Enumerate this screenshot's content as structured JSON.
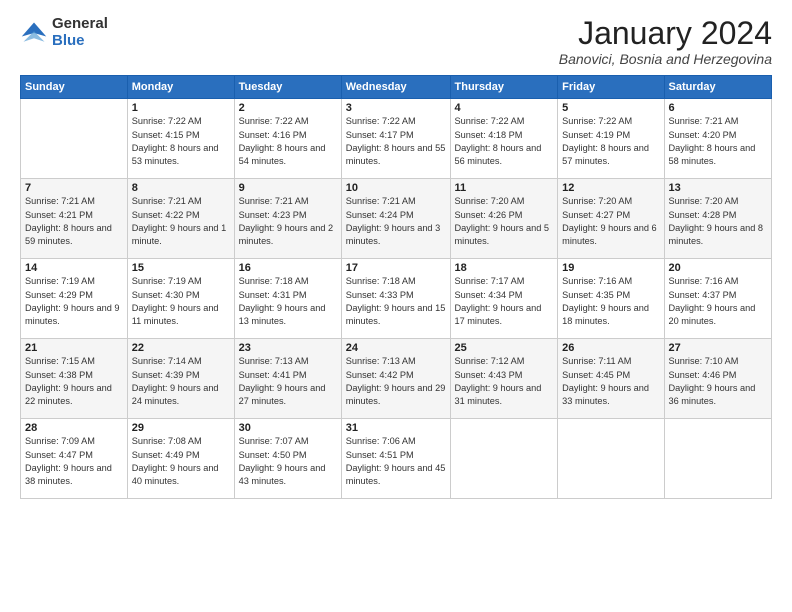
{
  "logo": {
    "general": "General",
    "blue": "Blue"
  },
  "header": {
    "title": "January 2024",
    "location": "Banovici, Bosnia and Herzegovina"
  },
  "weekdays": [
    "Sunday",
    "Monday",
    "Tuesday",
    "Wednesday",
    "Thursday",
    "Friday",
    "Saturday"
  ],
  "weeks": [
    [
      null,
      {
        "day": "1",
        "sunrise": "7:22 AM",
        "sunset": "4:15 PM",
        "daylight": "8 hours and 53 minutes."
      },
      {
        "day": "2",
        "sunrise": "7:22 AM",
        "sunset": "4:16 PM",
        "daylight": "8 hours and 54 minutes."
      },
      {
        "day": "3",
        "sunrise": "7:22 AM",
        "sunset": "4:17 PM",
        "daylight": "8 hours and 55 minutes."
      },
      {
        "day": "4",
        "sunrise": "7:22 AM",
        "sunset": "4:18 PM",
        "daylight": "8 hours and 56 minutes."
      },
      {
        "day": "5",
        "sunrise": "7:22 AM",
        "sunset": "4:19 PM",
        "daylight": "8 hours and 57 minutes."
      },
      {
        "day": "6",
        "sunrise": "7:21 AM",
        "sunset": "4:20 PM",
        "daylight": "8 hours and 58 minutes."
      }
    ],
    [
      {
        "day": "7",
        "sunrise": "7:21 AM",
        "sunset": "4:21 PM",
        "daylight": "8 hours and 59 minutes."
      },
      {
        "day": "8",
        "sunrise": "7:21 AM",
        "sunset": "4:22 PM",
        "daylight": "9 hours and 1 minute."
      },
      {
        "day": "9",
        "sunrise": "7:21 AM",
        "sunset": "4:23 PM",
        "daylight": "9 hours and 2 minutes."
      },
      {
        "day": "10",
        "sunrise": "7:21 AM",
        "sunset": "4:24 PM",
        "daylight": "9 hours and 3 minutes."
      },
      {
        "day": "11",
        "sunrise": "7:20 AM",
        "sunset": "4:26 PM",
        "daylight": "9 hours and 5 minutes."
      },
      {
        "day": "12",
        "sunrise": "7:20 AM",
        "sunset": "4:27 PM",
        "daylight": "9 hours and 6 minutes."
      },
      {
        "day": "13",
        "sunrise": "7:20 AM",
        "sunset": "4:28 PM",
        "daylight": "9 hours and 8 minutes."
      }
    ],
    [
      {
        "day": "14",
        "sunrise": "7:19 AM",
        "sunset": "4:29 PM",
        "daylight": "9 hours and 9 minutes."
      },
      {
        "day": "15",
        "sunrise": "7:19 AM",
        "sunset": "4:30 PM",
        "daylight": "9 hours and 11 minutes."
      },
      {
        "day": "16",
        "sunrise": "7:18 AM",
        "sunset": "4:31 PM",
        "daylight": "9 hours and 13 minutes."
      },
      {
        "day": "17",
        "sunrise": "7:18 AM",
        "sunset": "4:33 PM",
        "daylight": "9 hours and 15 minutes."
      },
      {
        "day": "18",
        "sunrise": "7:17 AM",
        "sunset": "4:34 PM",
        "daylight": "9 hours and 17 minutes."
      },
      {
        "day": "19",
        "sunrise": "7:16 AM",
        "sunset": "4:35 PM",
        "daylight": "9 hours and 18 minutes."
      },
      {
        "day": "20",
        "sunrise": "7:16 AM",
        "sunset": "4:37 PM",
        "daylight": "9 hours and 20 minutes."
      }
    ],
    [
      {
        "day": "21",
        "sunrise": "7:15 AM",
        "sunset": "4:38 PM",
        "daylight": "9 hours and 22 minutes."
      },
      {
        "day": "22",
        "sunrise": "7:14 AM",
        "sunset": "4:39 PM",
        "daylight": "9 hours and 24 minutes."
      },
      {
        "day": "23",
        "sunrise": "7:13 AM",
        "sunset": "4:41 PM",
        "daylight": "9 hours and 27 minutes."
      },
      {
        "day": "24",
        "sunrise": "7:13 AM",
        "sunset": "4:42 PM",
        "daylight": "9 hours and 29 minutes."
      },
      {
        "day": "25",
        "sunrise": "7:12 AM",
        "sunset": "4:43 PM",
        "daylight": "9 hours and 31 minutes."
      },
      {
        "day": "26",
        "sunrise": "7:11 AM",
        "sunset": "4:45 PM",
        "daylight": "9 hours and 33 minutes."
      },
      {
        "day": "27",
        "sunrise": "7:10 AM",
        "sunset": "4:46 PM",
        "daylight": "9 hours and 36 minutes."
      }
    ],
    [
      {
        "day": "28",
        "sunrise": "7:09 AM",
        "sunset": "4:47 PM",
        "daylight": "9 hours and 38 minutes."
      },
      {
        "day": "29",
        "sunrise": "7:08 AM",
        "sunset": "4:49 PM",
        "daylight": "9 hours and 40 minutes."
      },
      {
        "day": "30",
        "sunrise": "7:07 AM",
        "sunset": "4:50 PM",
        "daylight": "9 hours and 43 minutes."
      },
      {
        "day": "31",
        "sunrise": "7:06 AM",
        "sunset": "4:51 PM",
        "daylight": "9 hours and 45 minutes."
      },
      null,
      null,
      null
    ]
  ],
  "labels": {
    "sunrise": "Sunrise:",
    "sunset": "Sunset:",
    "daylight": "Daylight:"
  }
}
